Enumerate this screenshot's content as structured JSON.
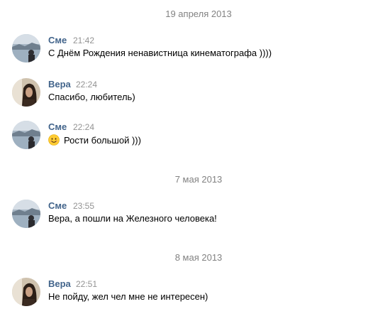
{
  "dates": {
    "d1": "19 апреля 2013",
    "d2": "7 мая 2013",
    "d3": "8 мая 2013"
  },
  "messages": [
    {
      "author": "Сме",
      "time": "21:42",
      "text": "С Днём Рождения ненавистница кинематографа ))))"
    },
    {
      "author": "Вера",
      "time": "22:24",
      "text": "Спасибо, любитель)"
    },
    {
      "author": "Сме",
      "time": "22:24",
      "text": "Рости большой )))",
      "emoji": "smiling-face"
    },
    {
      "author": "Сме",
      "time": "23:55",
      "text": "Вера, а пошли на Железного человека!"
    },
    {
      "author": "Вера",
      "time": "22:51",
      "text": "Не пойду, жел чел мне не интересен)"
    }
  ],
  "colors": {
    "author": "#42648b",
    "time": "#939393",
    "date": "#828282",
    "text": "#000000"
  }
}
